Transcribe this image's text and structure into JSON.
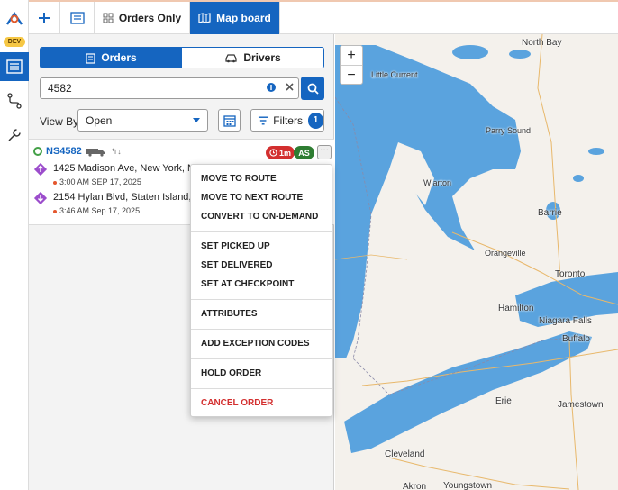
{
  "rail": {
    "env_badge": "DEV"
  },
  "topbar": {
    "tabs": [
      {
        "label": "Orders Only"
      },
      {
        "label": "Map board"
      }
    ]
  },
  "panel": {
    "segment": {
      "orders": "Orders",
      "drivers": "Drivers"
    },
    "search": {
      "value": "4582"
    },
    "view_by": {
      "label": "View By",
      "value": "Open"
    },
    "filters": {
      "label": "Filters",
      "count": "1"
    }
  },
  "order": {
    "number": "NS4582",
    "route_hint": "↰↓",
    "late_badge": "1m",
    "assignee_badge": "AS",
    "more": "···",
    "stops": [
      {
        "address": "1425 Madison Ave, New York, NY",
        "time": "3:00 AM SEP 17, 2025"
      },
      {
        "address": "2154 Hylan Blvd, Staten Island, NY",
        "time": "3:46 AM Sep 17, 2025"
      }
    ]
  },
  "context_menu": {
    "items": [
      "MOVE TO ROUTE",
      "MOVE TO NEXT ROUTE",
      "CONVERT TO ON-DEMAND",
      "SET PICKED UP",
      "SET DELIVERED",
      "SET AT CHECKPOINT",
      "ATTRIBUTES",
      "ADD EXCEPTION CODES",
      "HOLD ORDER",
      "CANCEL ORDER"
    ]
  },
  "map": {
    "zoom_in": "+",
    "zoom_out": "−",
    "labels": {
      "north_bay": "North Bay",
      "little_current": "Little Current",
      "parry_sound": "Parry Sound",
      "wiarton": "Wiarton",
      "barrie": "Barrie",
      "orangeville": "Orangeville",
      "toronto": "Toronto",
      "hamilton": "Hamilton",
      "niagara_falls": "Niagara Falls",
      "buffalo": "Buffalo",
      "erie": "Erie",
      "jamestown": "Jamestown",
      "cleveland": "Cleveland",
      "akron": "Akron",
      "youngstown": "Youngstown"
    }
  },
  "colors": {
    "primary": "#1565c0",
    "danger": "#d32f2f",
    "success": "#2e7d32",
    "water": "#5aa3de",
    "land": "#f4f1ec"
  }
}
